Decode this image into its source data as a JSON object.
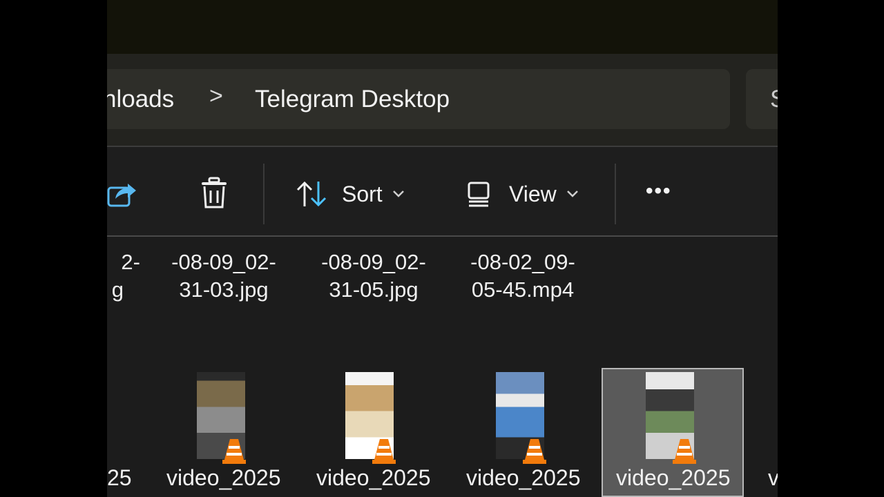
{
  "breadcrumb": {
    "previous": "nloads",
    "separator": ">",
    "current": "Telegram Desktop"
  },
  "search": {
    "partial": "S"
  },
  "toolbar": {
    "sort_label": "Sort",
    "view_label": "View",
    "more_label": "•••"
  },
  "files_row1": [
    {
      "line1": "2-",
      "line2": "g"
    },
    {
      "line1": "-08-09_02-",
      "line2": "31-03.jpg"
    },
    {
      "line1": "-08-09_02-",
      "line2": "31-05.jpg"
    },
    {
      "line1": "-08-02_09-",
      "line2": "05-45.mp4"
    }
  ],
  "files_row2": [
    {
      "label": "25"
    },
    {
      "label": "video_2025"
    },
    {
      "label": "video_2025"
    },
    {
      "label": "video_2025"
    },
    {
      "label": "video_2025"
    },
    {
      "label": "v"
    }
  ],
  "colors": {
    "accent": "#4cc2ff",
    "background": "#1c1c1c",
    "selection": "#5a5a5a",
    "vlc_orange": "#f27b0c"
  }
}
